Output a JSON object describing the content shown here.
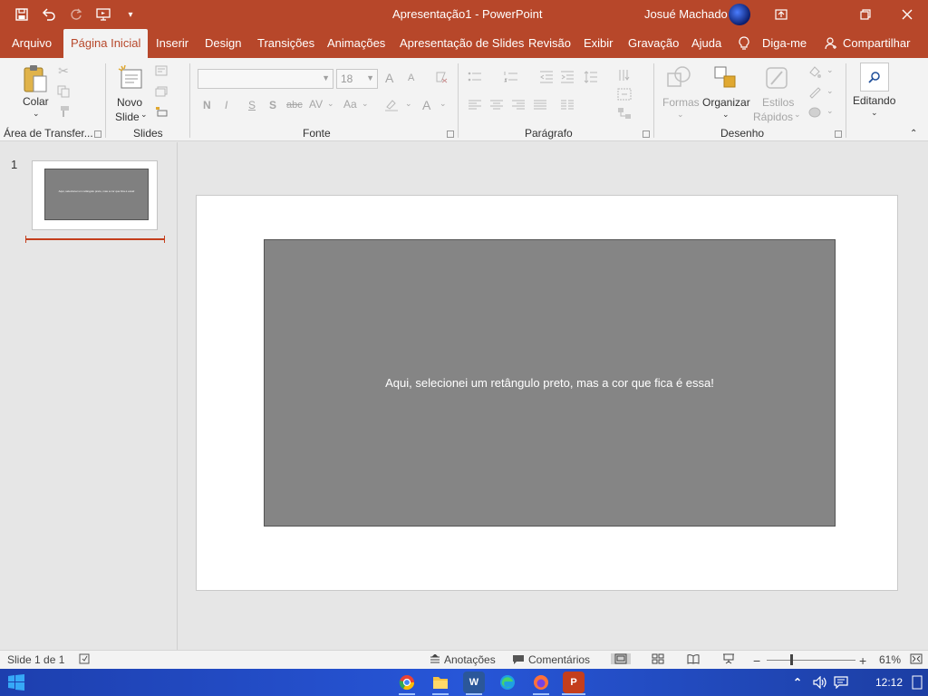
{
  "window": {
    "title": "Apresentação1  -  PowerPoint",
    "user": "Josué Machado"
  },
  "tabs": [
    "Arquivo",
    "Página Inicial",
    "Inserir",
    "Design",
    "Transições",
    "Animações",
    "Apresentação de Slides",
    "Revisão",
    "Exibir",
    "Gravação",
    "Ajuda"
  ],
  "tell_me": "Diga-me",
  "share": "Compartilhar",
  "ribbon": {
    "paste": "Colar",
    "new_slide_line1": "Novo",
    "new_slide_line2": "Slide",
    "font_name": "",
    "font_size": "18",
    "bold": "N",
    "italic": "I",
    "underline": "S",
    "shadow": "S",
    "strike": "abc",
    "spacing": "AV",
    "case": "Aa",
    "font_color": "A",
    "grow": "A",
    "shrink": "A",
    "shapes": "Formas",
    "arrange": "Organizar",
    "quick_styles_line1": "Estilos",
    "quick_styles_line2": "Rápidos",
    "editing": "Editando",
    "groups": {
      "clipboard": "Área de Transfer...",
      "slides": "Slides",
      "font": "Fonte",
      "paragraph": "Parágrafo",
      "drawing": "Desenho"
    }
  },
  "thumbnails": [
    {
      "number": "1",
      "text": "Aqui, selecionei um retângulo preto, mas a cor que fica é essa!"
    }
  ],
  "slide": {
    "shape_text": "Aqui, selecionei um retângulo preto, mas a cor que fica é essa!",
    "shape_fill": "#858585"
  },
  "status": {
    "slide_info": "Slide 1 de 1",
    "notes": "Anotações",
    "comments": "Comentários",
    "zoom": "61%",
    "zoom_level": 0.61
  },
  "taskbar": {
    "time": "12:12",
    "apps": [
      "chrome-icon",
      "file-explorer-icon",
      "word-icon",
      "edge-icon",
      "firefox-icon",
      "powerpoint-icon"
    ]
  },
  "colors": {
    "accent": "#b7472a",
    "ribbon_bg": "#f3f3f3"
  }
}
